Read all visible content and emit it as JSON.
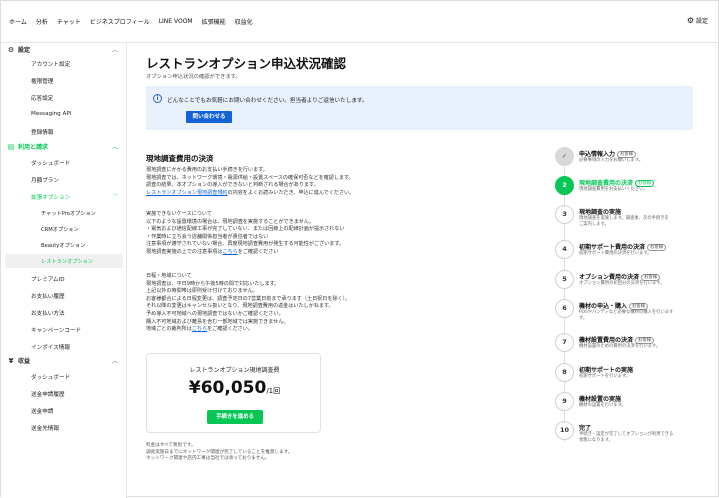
{
  "topnav": {
    "items": [
      "ホーム",
      "分析",
      "チャット",
      "ビジネスプロフィール",
      "LINE VOOM",
      "拡張機能",
      "収益化"
    ],
    "settings_label": "設定"
  },
  "sidebar": {
    "settings_section": "設定",
    "settings_items": [
      "アカウント設定",
      "権限管理",
      "応答設定",
      "Messaging API",
      "登録情報"
    ],
    "usage_section": "利用と請求",
    "usage_items": [
      "ダッシュボード",
      "月額プラン"
    ],
    "extension_label": "拡張オプション",
    "extension_subitems": [
      "チャットProオプション",
      "CRMオプション",
      "Beautyオプション",
      "レストランオプション"
    ],
    "usage_items2": [
      "プレミアムID",
      "お支払い履歴",
      "お支払い方法",
      "キャンペーンコード",
      "インボイス情報"
    ],
    "revenue_section": "収益",
    "revenue_items": [
      "ダッシュボード",
      "送金申請履歴",
      "送金申請",
      "送金先情報"
    ]
  },
  "main": {
    "title": "レストランオプション申込状況確認",
    "subtitle": "オプション申込状況の確認ができます。",
    "info": {
      "text": "どんなことでもお気軽にお問い合わせください。担当者よりご返信いたします。",
      "button": "問い合わせる"
    },
    "section_title": "現地調査費用の決済",
    "para1": [
      "現地調査にかかる費用のお支払い手続きを行います。",
      "現地調査では、ネットワーク環境・電源供給・設置スペースの確保可否などを確認します。",
      "調査の結果、本オプションの導入ができないと判断される場合があります。"
    ],
    "para1_link": "レストランオプション現地調査規約",
    "para1_link_after": "の内容をよくお読みいただき、申込に進んでください。",
    "para2": [
      "実施できないケースについて",
      "以下のような設置環境の場合は、現地調査を実施することができません。",
      "・電気および通信配線工事が完了していない、または回線上の配線計画が提示されない",
      "・作業時に立ち会う店舗関係担当者が責任者ではない",
      "注意事項が遵守されていない場合、再度現地調査費用が発生する可能性がございます。"
    ],
    "para2_last_before": "現地調査実施の上での注意事項は",
    "para2_link": "こちら",
    "para2_last_after": "をご確認ください",
    "para3": [
      "日程・地域について",
      "現地調査は、平日9時から午後5時の間で対応いたします。",
      "上記以外の時間帯は原則受け付けておりません。",
      "お客様都合による日程変更は、調査予定日の7営業日前まで承ります（土日祝日を除く）。",
      "それ以降の変更はキャンセル扱いとなり、現地調査費用の返金はいたしかねます。",
      "予め導入不可地域への現地調査ではないかご確認ください。",
      "購入不可地域および離島を含む一部地域では実施できません。"
    ],
    "para3_last_before": "地域ごとの裁判所は",
    "para3_link": "こちら",
    "para3_last_after": "をご確認ください。",
    "fee": {
      "label": "レストランオプション現地調査費",
      "amount": "¥60,050",
      "unit": "/1回",
      "button": "手続きを進める"
    },
    "notes": [
      "料金はすべて税別です。",
      "調査実施日までにネットワーク関連が完了していることを推奨します。",
      "ネットワーク関連や店内工事は当社では承っておりません。"
    ]
  },
  "steps": [
    {
      "num": "✓",
      "title": "申込情報入力",
      "badge": "お客様",
      "desc": [
        "必要事項の入力をお願いします。"
      ],
      "state": "done"
    },
    {
      "num": "2",
      "title": "現地調査費用の決済",
      "badge": "お客様",
      "desc": [
        "現地調査費用をお支払いください。"
      ],
      "state": "active"
    },
    {
      "num": "3",
      "title": "現地調査の実施",
      "badge": "",
      "desc": [
        "現地調査を実施します。調査後、次の手続きを",
        "ご案内します。"
      ],
      "state": "todo"
    },
    {
      "num": "4",
      "title": "初期サポート費用の決済",
      "badge": "お客様",
      "desc": [
        "初期サポート費用の決済を行います。"
      ],
      "state": "todo"
    },
    {
      "num": "5",
      "title": "オプション費用の決済",
      "badge": "お客様",
      "desc": [
        "オプション費用の初回分の決済を行います。"
      ],
      "state": "todo"
    },
    {
      "num": "6",
      "title": "機材の申込・購入",
      "badge": "お客様",
      "desc": [
        "POSやハンディなど必要な機材の購入を行います",
        "す。"
      ],
      "state": "todo"
    },
    {
      "num": "7",
      "title": "機材設置費用の決済",
      "badge": "お客様",
      "desc": [
        "機材設置のための費用の決済を行います。"
      ],
      "state": "todo"
    },
    {
      "num": "8",
      "title": "初期サポートの実施",
      "badge": "",
      "desc": [
        "初期サポートを行います。"
      ],
      "state": "todo"
    },
    {
      "num": "9",
      "title": "機材設置の実施",
      "badge": "",
      "desc": [
        "機材の設置を行います。"
      ],
      "state": "todo"
    },
    {
      "num": "10",
      "title": "完了",
      "badge": "",
      "desc": [
        "手続き・設定が完了してオプションが利用できる",
        "状態になります。"
      ],
      "state": "todo"
    }
  ]
}
